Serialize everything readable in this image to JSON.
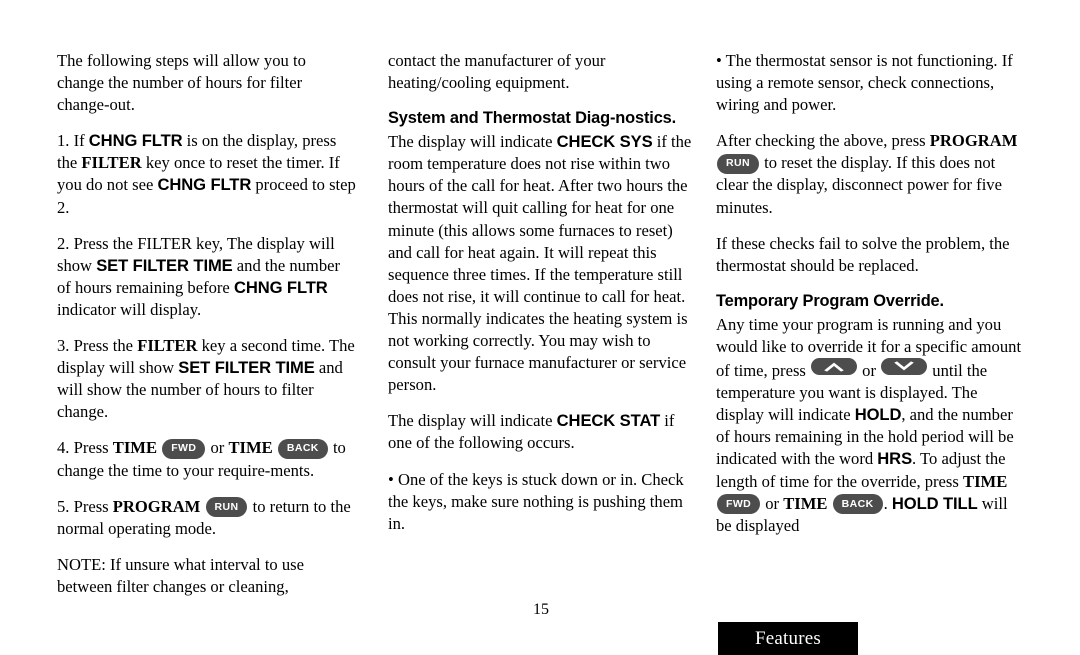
{
  "document": {
    "page_number": "15",
    "section_tab_label": "Features",
    "pill_color": "#4d4d4d",
    "tab_color": "#000000",
    "background_color": "#ffffff"
  },
  "columns": {
    "left": {
      "intro": {
        "text": "The following steps will allow you to change the number of hours for filter change-out."
      },
      "step1": {
        "a": "1. If ",
        "lcd1": "CHNG FLTR",
        "b": " is on the display, press the ",
        "key1": "FILTER",
        "c": " key once to reset the timer. If you do not see ",
        "lcd2": "CHNG FLTR",
        "d": " proceed to step 2."
      },
      "step2": {
        "a": "2. Press the FILTER key, The display will show ",
        "lcd1": "SET FILTER TIME",
        "b": " and the number of hours remaining before ",
        "lcd2": "CHNG FLTR",
        "c": " indicator will display."
      },
      "step3": {
        "a": "3. Press the ",
        "key1": "FILTER",
        "b": " key a second time. The display will show ",
        "lcd1": "SET FILTER TIME",
        "c": " and will show the number of hours to filter change."
      },
      "step4": {
        "a": "4. Press ",
        "key1": "TIME",
        "pill1": "FWD",
        "b": " or ",
        "key2": "TIME",
        "pill2": "BACK",
        "c": " to change the time to your require-ments."
      },
      "step5": {
        "a": "5. Press ",
        "key1": "PROGRAM",
        "pill1": "RUN",
        "b": " to return to the normal operating mode."
      },
      "note": {
        "text": "NOTE: If unsure what interval to use between filter changes or cleaning,"
      }
    },
    "middle": {
      "continuation": {
        "text": "contact the manufacturer of your heating/cooling equipment."
      },
      "heading": "System and Thermostat Diag-nostics.",
      "check_sys": {
        "a": "The display will indicate ",
        "lcd1": "CHECK SYS",
        "b": " if the room temperature does not rise within two hours of the call for heat. After two hours the thermostat will quit calling for heat for one minute (this allows some furnaces to reset) and call for heat again. It will repeat this sequence three times. If the temperature still does not rise, it will continue to call for heat. This normally indicates the heating system is not working correctly. You may wish to consult your furnace manufacturer or service person."
      },
      "check_stat": {
        "a": "The display will indicate ",
        "lcd1": "CHECK STAT",
        "b": " if one of the following occurs."
      },
      "bullet1": {
        "text": "• One of the keys is stuck down or in. Check the keys, make sure nothing is pushing them in."
      }
    },
    "right": {
      "bullet2": {
        "text": "• The thermostat sensor is not functioning. If using a remote sensor, check connections, wiring and power."
      },
      "after_checking": {
        "a": "After checking the above, press ",
        "key1": "PROGRAM",
        "pill1": "RUN",
        "b": " to reset the display. If this does not clear the display, disconnect power for five minutes."
      },
      "if_fail": {
        "text": "If these checks fail to solve the problem, the thermostat should be replaced."
      },
      "heading": "Temporary Program Override.",
      "override": {
        "a": "Any time your program is running and you would like to override it for a specific amount of time, press ",
        "pill_up": "chevron-up-icon",
        "b": " or ",
        "pill_down": "chevron-down-icon",
        "c": " until the temperature you want is displayed. The display will indicate ",
        "lcd1": "HOLD",
        "d": ", and the number of hours remaining in the hold period will be indicated with the word ",
        "lcd2": "HRS",
        "e": ". To adjust the length of time for the override, press ",
        "key1": "TIME",
        "pill1": "FWD",
        "f": " or ",
        "key2": "TIME",
        "pill2": "BACK",
        "g": ". ",
        "lcd3": "HOLD TILL",
        "h": " will be displayed"
      }
    }
  }
}
